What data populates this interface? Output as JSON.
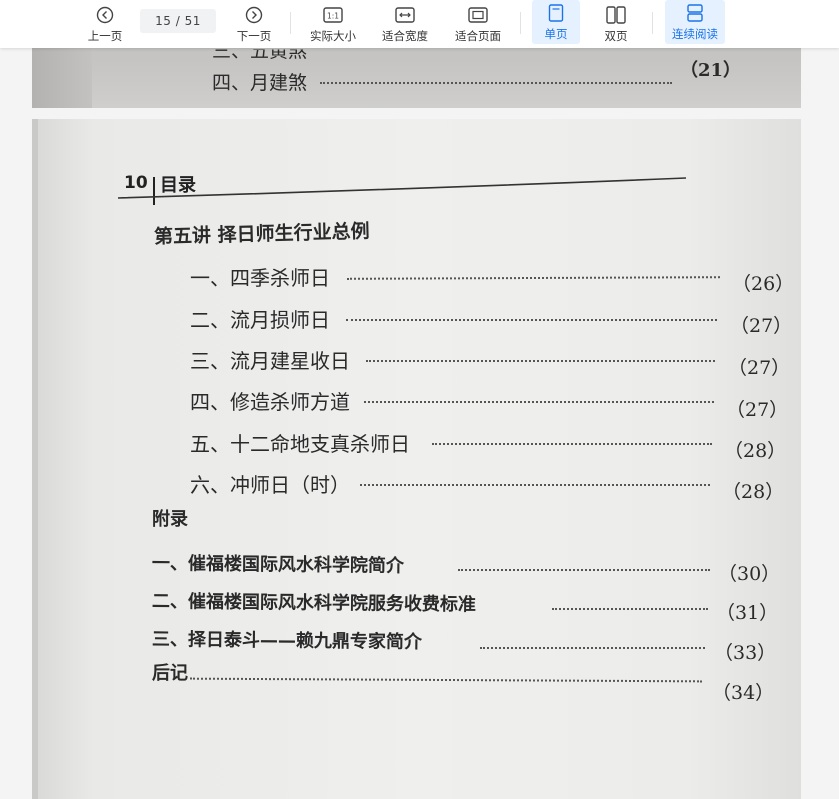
{
  "toolbar": {
    "prev_label": "上一页",
    "page_indicator": "15 / 51",
    "next_label": "下一页",
    "actual_size_label": "实际大小",
    "fit_width_label": "适合宽度",
    "fit_page_label": "适合页面",
    "single_page_label": "单页",
    "double_page_label": "双页",
    "continuous_label": "连续阅读",
    "accent_color": "#1a73e8"
  },
  "prev_page": {
    "line_partial": "三、五黄煞",
    "line_last": "四、月建煞",
    "line_last_page": "（21）"
  },
  "page": {
    "header_number": "10",
    "header_title": "目录",
    "section_title": "第五讲  择日师生行业总例",
    "items": [
      {
        "text": "一、四季杀师日",
        "page": "（26）"
      },
      {
        "text": "二、流月损师日",
        "page": "（27）"
      },
      {
        "text": "三、流月建星收日",
        "page": "（27）"
      },
      {
        "text": "四、修造杀师方道",
        "page": "（27）"
      },
      {
        "text": "五、十二命地支真杀师日",
        "page": "（28）"
      },
      {
        "text": "六、冲师日（时）",
        "page": "（28）"
      }
    ],
    "appendix_title": "附录",
    "appendix_items": [
      {
        "text": "一、催福楼国际风水科学院简介",
        "page": "（30）"
      },
      {
        "text": "二、催福楼国际风水科学院服务收费标准",
        "page": "（31）"
      },
      {
        "text": "三、择日泰斗——赖九鼎专家简介",
        "page": "（33）"
      }
    ],
    "postscript": {
      "text": "后记",
      "page": "（34）"
    }
  }
}
